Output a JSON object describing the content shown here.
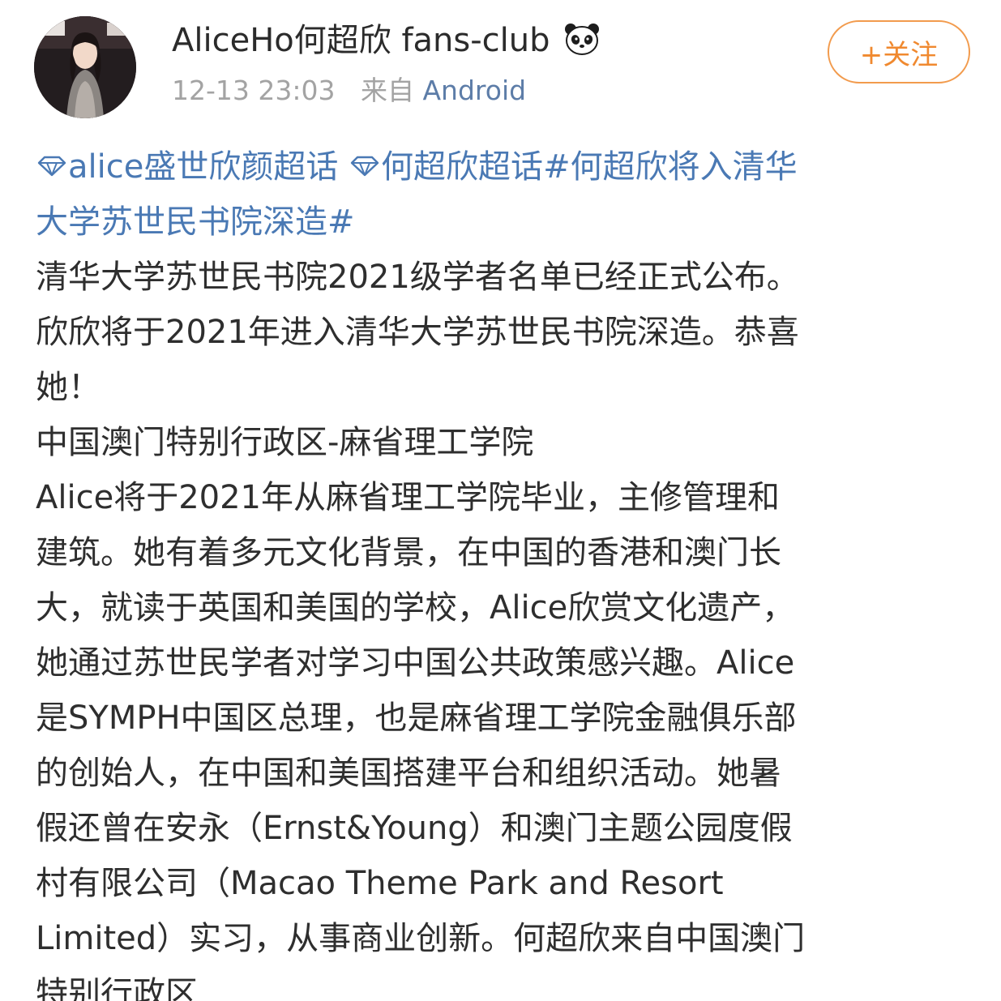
{
  "header": {
    "author_name": "AliceHo何超欣 fans-club",
    "badge_icon": "panda-icon",
    "timestamp": "12-13 23:03",
    "source_prefix": "来自",
    "source": "Android",
    "follow_label": "+关注",
    "follow_color": "#f0892f"
  },
  "post": {
    "link_color": "#4a79b4",
    "topic_1": "alice盛世欣颜超话",
    "topic_2": "何超欣超话",
    "hashtag_part1": "#何超欣将入清华",
    "hashtag_part2": "大学苏世民书院深造#",
    "lines": [
      "清华大学苏世民书院2021级学者名单已经正式公布。",
      "欣欣将于2021年进入清华大学苏世民书院深造。恭喜",
      "她！",
      "中国澳门特别行政区-麻省理工学院",
      "Alice将于2021年从麻省理工学院毕业，主修管理和",
      "建筑。她有着多元文化背景，在中国的香港和澳门长",
      "大，就读于英国和美国的学校，Alice欣赏文化遗产，",
      "她通过苏世民学者对学习中国公共政策感兴趣。Alice",
      "是SYMPH中国区总理，也是麻省理工学院金融俱乐部",
      "的创始人，在中国和美国搭建平台和组织活动。她暑",
      "假还曾在安永（Ernst&Young）和澳门主题公园度假",
      "村有限公司（Macao Theme Park and Resort",
      "Limited）实习，从事商业创新。何超欣来自中国澳门",
      "特别行政区"
    ]
  }
}
